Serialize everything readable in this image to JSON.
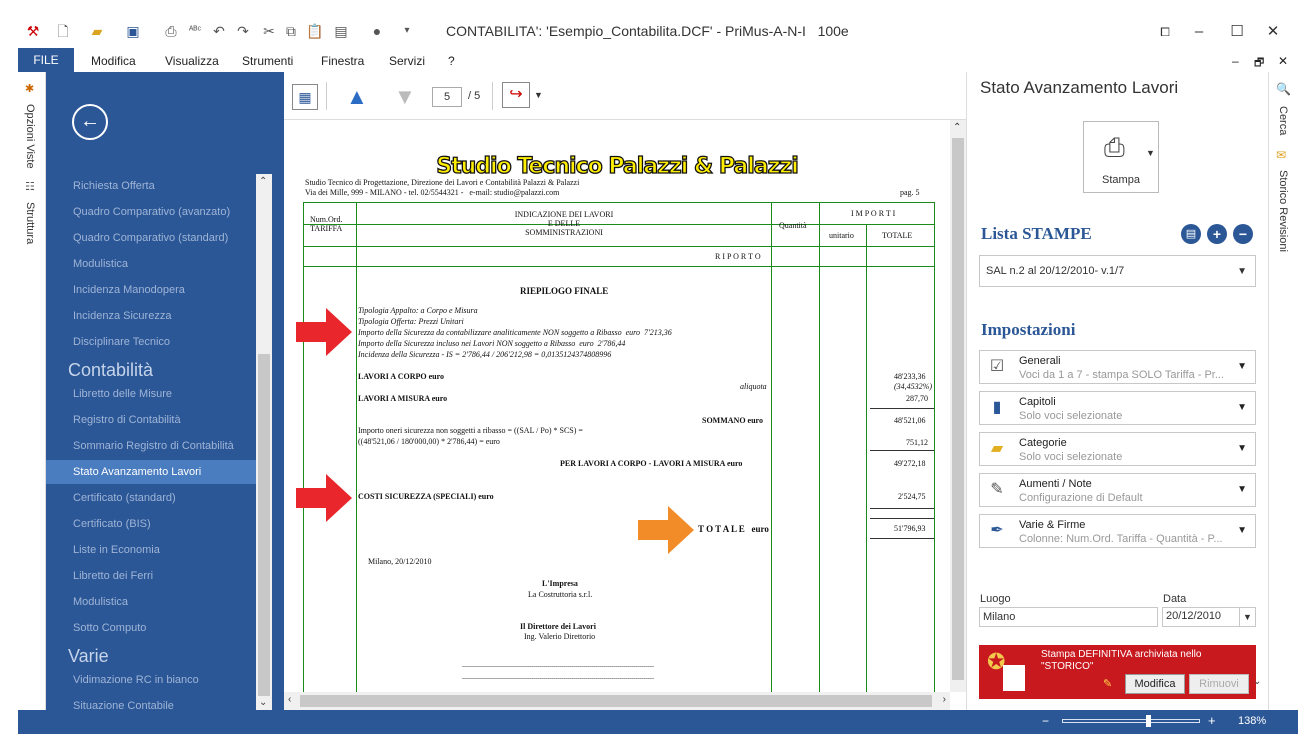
{
  "window": {
    "title": "CONTABILITA': 'Esempio_Contabilita.DCF' - PriMus-A-N-I   100e",
    "controls": {
      "restore": "⧠",
      "minimize": "–",
      "maximize": "☐",
      "close": "✕"
    }
  },
  "menu": {
    "file": "FILE",
    "items": [
      "Modifica",
      "Visualizza",
      "Strumenti",
      "Finestra",
      "Servizi",
      "?"
    ],
    "right_controls": [
      "–",
      "🗗",
      "✕"
    ]
  },
  "left_strip": {
    "tabs": [
      "Opzioni Viste",
      "Struttura"
    ]
  },
  "nav": {
    "items_top": [
      "Richiesta Offerta",
      "Quadro Comparativo (avanzato)",
      "Quadro Comparativo (standard)",
      "Modulistica",
      "Incidenza Manodopera",
      "Incidenza Sicurezza",
      "Disciplinare Tecnico"
    ],
    "section_contabilita": "Contabilità",
    "items_contabilita": [
      "Libretto delle Misure",
      "Registro di Contabilità",
      "Sommario Registro di Contabilità",
      "Stato Avanzamento Lavori",
      "Certificato (standard)",
      "Certificato (BIS)",
      "Liste in Economia",
      "Libretto dei Ferri",
      "Modulistica",
      "Sotto Computo"
    ],
    "selected": "Stato Avanzamento Lavori",
    "section_varie": "Varie",
    "items_varie": [
      "Vidimazione RC in bianco",
      "Situazione Contabile"
    ]
  },
  "preview_toolbar": {
    "page": "5",
    "total": "/ 5"
  },
  "document": {
    "banner": "Studio Tecnico Palazzi & Palazzi",
    "firm_line1": "Studio Tecnico di Progettazione, Direzione dei Lavori e Contabilità Palazzi & Palazzi",
    "firm_line2": "Via dei Mille, 999 - MILANO - tel. 02/5544321 -   e-mail: studio@palazzi.com",
    "page_no": "pag. 5",
    "col_num": "Num.Ord.\nTARIFFA",
    "col_desc": "INDICAZIONE DEI LAVORI\nE DELLE\nSOMMINISTRAZIONI",
    "col_qty": "Quantità",
    "col_importi": "I M P O R T I",
    "col_unit": "unitario",
    "col_tot": "TOTALE",
    "riporto": "R I P O R T O",
    "riepilogo": "RIEPILOGO FINALE",
    "notes": [
      "Tipologia Appalto: a Corpo e Misura",
      "Tipologia Offerta: Prezzi Unitari",
      "Importo della Sicurezza da contabilizzare analiticamente NON soggetto a Ribasso  euro  7'213,36",
      "Importo della Sicurezza incluso nei Lavori NON soggetto a Ribasso  euro  2'786,44",
      "Incidenza della Sicurezza - IS = 2'786,44 / 206'212,98 = 0,0135124374808996"
    ],
    "lav_corpo": "LAVORI A CORPO euro",
    "aliquota": "aliquota",
    "val_corpo": "48'233,36",
    "val_aliquota": "(34,4532%)",
    "lav_misura": "LAVORI A MISURA euro",
    "val_misura": "287,70",
    "sommano": "SOMMANO euro",
    "val_sommano": "48'521,06",
    "oneri1": "Importo oneri sicurezza non soggetti a ribasso = ((SAL / Po) * SCS) =",
    "oneri2": "((48'521,06 / 180'000,00) * 2'786,44) = euro",
    "val_oneri": "751,12",
    "per_lavori": "PER LAVORI A CORPO - LAVORI A MISURA euro",
    "val_per_lavori": "49'272,18",
    "costi_sic": "COSTI SICUREZZA (SPECIALI) euro",
    "val_costi": "2'524,75",
    "totale": "T O T A L E   euro",
    "val_totale": "51'796,93",
    "luogo_data": "Milano, 20/12/2010",
    "impresa_t": "L'Impresa",
    "impresa_n": "La Costruttoria s.r.l.",
    "direttore_t": "Il Direttore dei Lavori",
    "direttore_n": "Ing. Valerio Direttorio",
    "sign_line": "------------------------------------------------------------------------------------------------"
  },
  "panel": {
    "title": "Stato Avanzamento Lavori",
    "print_label": "Stampa",
    "lista_title": "Lista STAMPE",
    "lista_value": "SAL n.2 al 20/12/2010- v.1/7",
    "impostazioni_title": "Impostazioni",
    "settings": [
      {
        "title": "Generali",
        "sub": "Voci da 1 a 7 - stampa SOLO Tariffa - Pr..."
      },
      {
        "title": "Capitoli",
        "sub": "Solo voci selezionate"
      },
      {
        "title": "Categorie",
        "sub": "Solo voci selezionate"
      },
      {
        "title": "Aumenti / Note",
        "sub": "Configurazione di Default"
      },
      {
        "title": "Varie & Firme",
        "sub": "Colonne: Num.Ord. Tariffa - Quantità - P..."
      }
    ],
    "luogo_label": "Luogo",
    "luogo_value": "Milano",
    "data_label": "Data",
    "data_value": "20/12/2010",
    "definitiva_text": "Stampa DEFINITIVA archiviata nello \"STORICO\"",
    "modifica": "Modifica",
    "rimuovi": "Rimuovi"
  },
  "right_strip": {
    "tabs": [
      "Cerca",
      "Storico Revisioni"
    ]
  },
  "statusbar": {
    "zoom": "138%"
  }
}
